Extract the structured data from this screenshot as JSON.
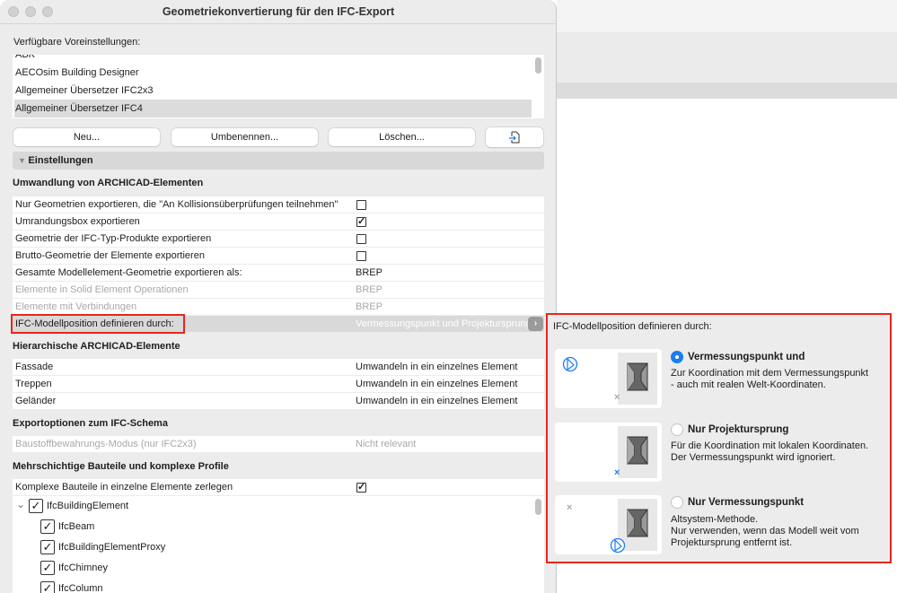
{
  "window": {
    "title": "Geometriekonvertierung für den IFC-Export"
  },
  "presets": {
    "label": "Verfügbare Voreinstellungen:",
    "items": [
      "ABK",
      "AECOsim Building Designer",
      "Allgemeiner Übersetzer IFC2x3",
      "Allgemeiner Übersetzer IFC4"
    ],
    "selected": "Allgemeiner Übersetzer IFC4"
  },
  "buttons": {
    "new": "Neu...",
    "rename": "Umbenennen...",
    "delete": "Löschen..."
  },
  "settings_group": "Einstellungen",
  "sections": {
    "conversion": {
      "heading": "Umwandlung von ARCHICAD-Elementen",
      "rows": [
        {
          "label": "Nur Geometrien exportieren, die \"An Kollisionsüberprüfungen teilnehmen\"",
          "checked": false
        },
        {
          "label": "Umrandungsbox exportieren",
          "checked": true,
          "mark": "✓"
        },
        {
          "label": "Geometrie der IFC-Typ-Produkte exportieren",
          "checked": false
        },
        {
          "label": "Brutto-Geometrie der Elemente exportieren",
          "checked": false
        },
        {
          "label": "Gesamte Modellelement-Geometrie exportieren als:",
          "value": "BREP"
        },
        {
          "label": "Elemente in Solid Element Operationen",
          "value": "BREP"
        },
        {
          "label": "Elemente mit Verbindungen",
          "value": "BREP"
        },
        {
          "label": "IFC-Modellposition definieren durch:",
          "value": "Vermessungspunkt und Projektursprung"
        }
      ]
    },
    "hierarchical": {
      "heading": "Hierarchische ARCHICAD-Elemente",
      "rows": [
        {
          "label": "Fassade",
          "value": "Umwandeln in ein einzelnes Element"
        },
        {
          "label": "Treppen",
          "value": "Umwandeln in ein einzelnes Element"
        },
        {
          "label": "Geländer",
          "value": "Umwandeln in ein einzelnes Element"
        }
      ]
    },
    "schema": {
      "heading": "Exportoptionen zum IFC-Schema",
      "rows": [
        {
          "label": "Baustoffbewahrungs-Modus (nur IFC2x3)",
          "value": "Nicht relevant"
        }
      ]
    },
    "multilayer": {
      "heading": "Mehrschichtige Bauteile und komplexe Profile",
      "rows": [
        {
          "label": "Komplexe Bauteile in einzelne Elemente zerlegen",
          "checked": true,
          "mark": "✓"
        }
      ],
      "tree": [
        {
          "label": "IfcBuildingElement",
          "checked": true
        },
        {
          "label": "IfcBeam",
          "checked": true
        },
        {
          "label": "IfcBuildingElementProxy",
          "checked": true
        },
        {
          "label": "IfcChimney",
          "checked": true
        },
        {
          "label": "IfcColumn",
          "checked": true
        }
      ],
      "check_mark": "✓",
      "chevron": "⌄"
    }
  },
  "popup": {
    "title": "IFC-Modellposition definieren durch:",
    "marker": "×",
    "options": [
      {
        "title": "Vermessungspunkt und",
        "desc1": "Zur Koordination mit dem Vermessungspunkt",
        "desc2": "- auch mit realen Welt-Koordinaten.",
        "selected": true
      },
      {
        "title": "Nur Projektursprung",
        "desc1": "Für die Koordination mit lokalen Koordinaten.",
        "desc2": "Der Vermessungspunkt wird ignoriert.",
        "selected": false
      },
      {
        "title": "Nur Vermessungspunkt",
        "desc1": "Altsystem-Methode.",
        "desc2": "Nur verwenden, wenn das Modell weit vom",
        "desc3": "Projektursprung entfernt ist.",
        "selected": false
      }
    ]
  },
  "colors": {
    "accent": "#1a7cf5",
    "highlight_border": "#e8261c"
  }
}
